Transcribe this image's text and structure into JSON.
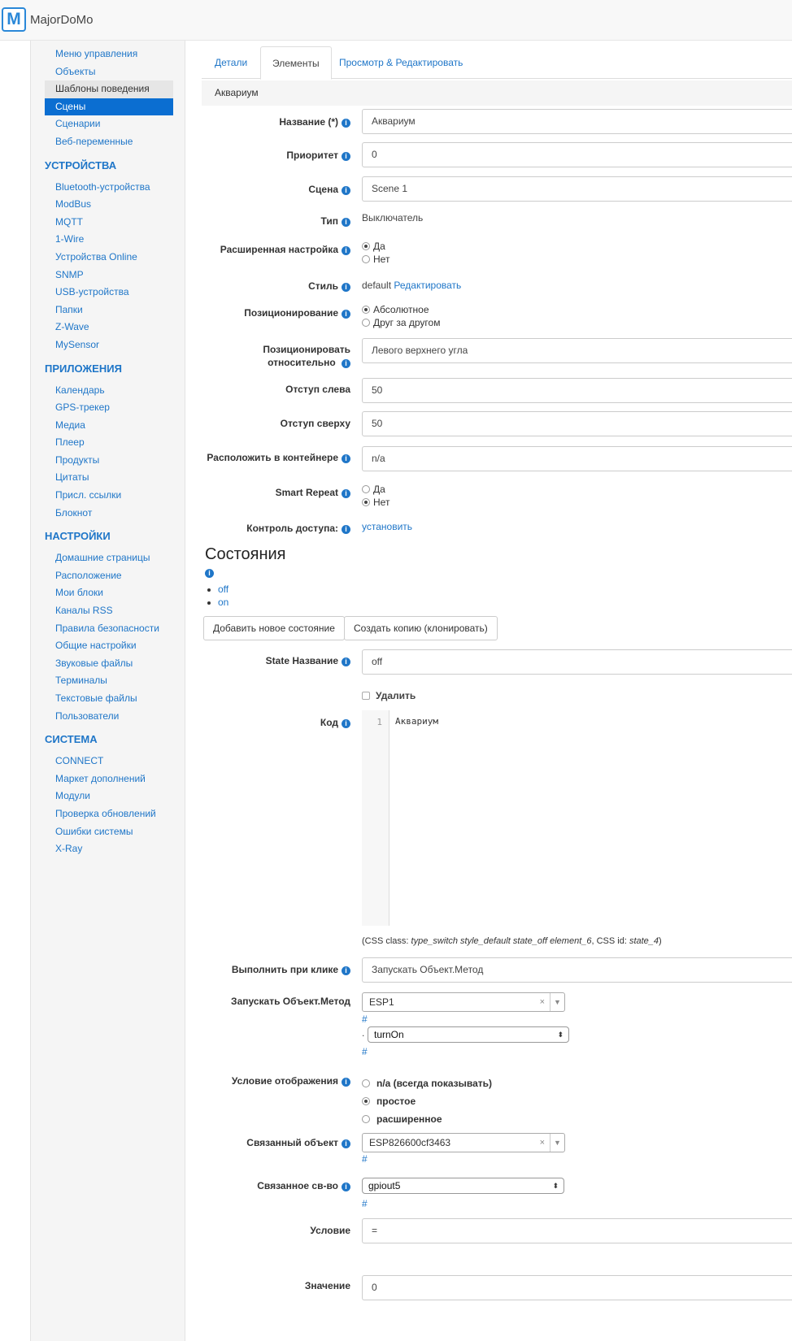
{
  "app": {
    "brand_letter": "M",
    "brand_name": "MajorDoMo"
  },
  "sidebar": {
    "top_items": [
      "Меню управления",
      "Объекты",
      "Шаблоны поведения",
      "Сцены",
      "Сценарии",
      "Веб-переменные"
    ],
    "hover_index": 2,
    "active_index": 3,
    "sections": [
      {
        "title": "УСТРОЙСТВА",
        "items": [
          "Bluetooth-устройства",
          "ModBus",
          "MQTT",
          "1-Wire",
          "Устройства Online",
          "SNMP",
          "USB-устройства",
          "Папки",
          "Z-Wave",
          "MySensor"
        ]
      },
      {
        "title": "ПРИЛОЖЕНИЯ",
        "items": [
          "Календарь",
          "GPS-трекер",
          "Медиа",
          "Плеер",
          "Продукты",
          "Цитаты",
          "Присл. ссылки",
          "Блокнот"
        ]
      },
      {
        "title": "НАСТРОЙКИ",
        "items": [
          "Домашние страницы",
          "Расположение",
          "Мои блоки",
          "Каналы RSS",
          "Правила безопасности",
          "Общие настройки",
          "Звуковые файлы",
          "Терминалы",
          "Текстовые файлы",
          "Пользователи"
        ]
      },
      {
        "title": "СИСТЕМА",
        "items": [
          "CONNECT",
          "Маркет дополнений",
          "Модули",
          "Проверка обновлений",
          "Ошибки системы",
          "X-Ray"
        ]
      }
    ]
  },
  "tabs": [
    "Детали",
    "Элементы",
    "Просмотр & Редактировать"
  ],
  "active_tab": 1,
  "breadcrumb": "Аквариум",
  "info_glyph": "i",
  "form": {
    "name_label": "Название (*)",
    "name_value": "Аквариум",
    "priority_label": "Приоритет",
    "priority_value": "0",
    "scene_label": "Сцена",
    "scene_value": "Scene 1",
    "type_label": "Тип",
    "type_value": "Выключатель",
    "advanced_label": "Расширенная настройка",
    "advanced_options": [
      "Да",
      "Нет"
    ],
    "advanced_selected": 0,
    "style_label": "Стиль",
    "style_value": "default",
    "style_edit_link": "Редактировать",
    "positioning_label": "Позиционирование",
    "positioning_options": [
      "Абсолютное",
      "Друг за другом"
    ],
    "positioning_selected": 0,
    "position_rel_label": "Позиционировать относительно",
    "position_rel_value": "Левого верхнего угла",
    "left_label": "Отступ слева",
    "left_value": "50",
    "top_label": "Отступ сверху",
    "top_value": "50",
    "container_label": "Расположить в контейнере",
    "container_value": "n/a",
    "smart_repeat_label": "Smart Repeat",
    "smart_repeat_options": [
      "Да",
      "Нет"
    ],
    "smart_repeat_selected": 1,
    "access_label": "Контроль доступа:",
    "access_link": "установить"
  },
  "states_section": {
    "title": "Состояния",
    "items": [
      "off",
      "on"
    ],
    "add_button": "Добавить новое состояние",
    "clone_button": "Создать копию (клонировать)",
    "state_name_label": "State Название",
    "state_name_value": "off",
    "delete_label": "Удалить",
    "code_label": "Код",
    "code_line_number": "1",
    "code_text": "Аквариум",
    "css_prefix": "(CSS class: ",
    "css_class": "type_switch style_default state_off element_6",
    "css_mid": ", CSS id: ",
    "css_id": "state_4",
    "css_suffix": ")",
    "onclick_label": "Выполнить при клике",
    "onclick_value": "Запускать Объект.Метод",
    "run_method_label": "Запускать Объект.Метод",
    "run_object_value": "ESP1",
    "hash": "#",
    "dot": ".",
    "method_value": "turnOn",
    "display_cond_label": "Условие отображения",
    "display_cond_options": [
      "n/a (всегда показывать)",
      "простое",
      "расширенное"
    ],
    "display_cond_selected": 1,
    "linked_object_label": "Связанный объект",
    "linked_object_value": "ESP826600cf3463",
    "linked_prop_label": "Связанное св-во",
    "linked_prop_value": "gpiout5",
    "condition_label": "Условие",
    "condition_value": "=",
    "value_label": "Значение",
    "value_value": "0",
    "clear_glyph": "×",
    "dropdown_glyph": "▼",
    "updown_glyph": "⬍"
  }
}
